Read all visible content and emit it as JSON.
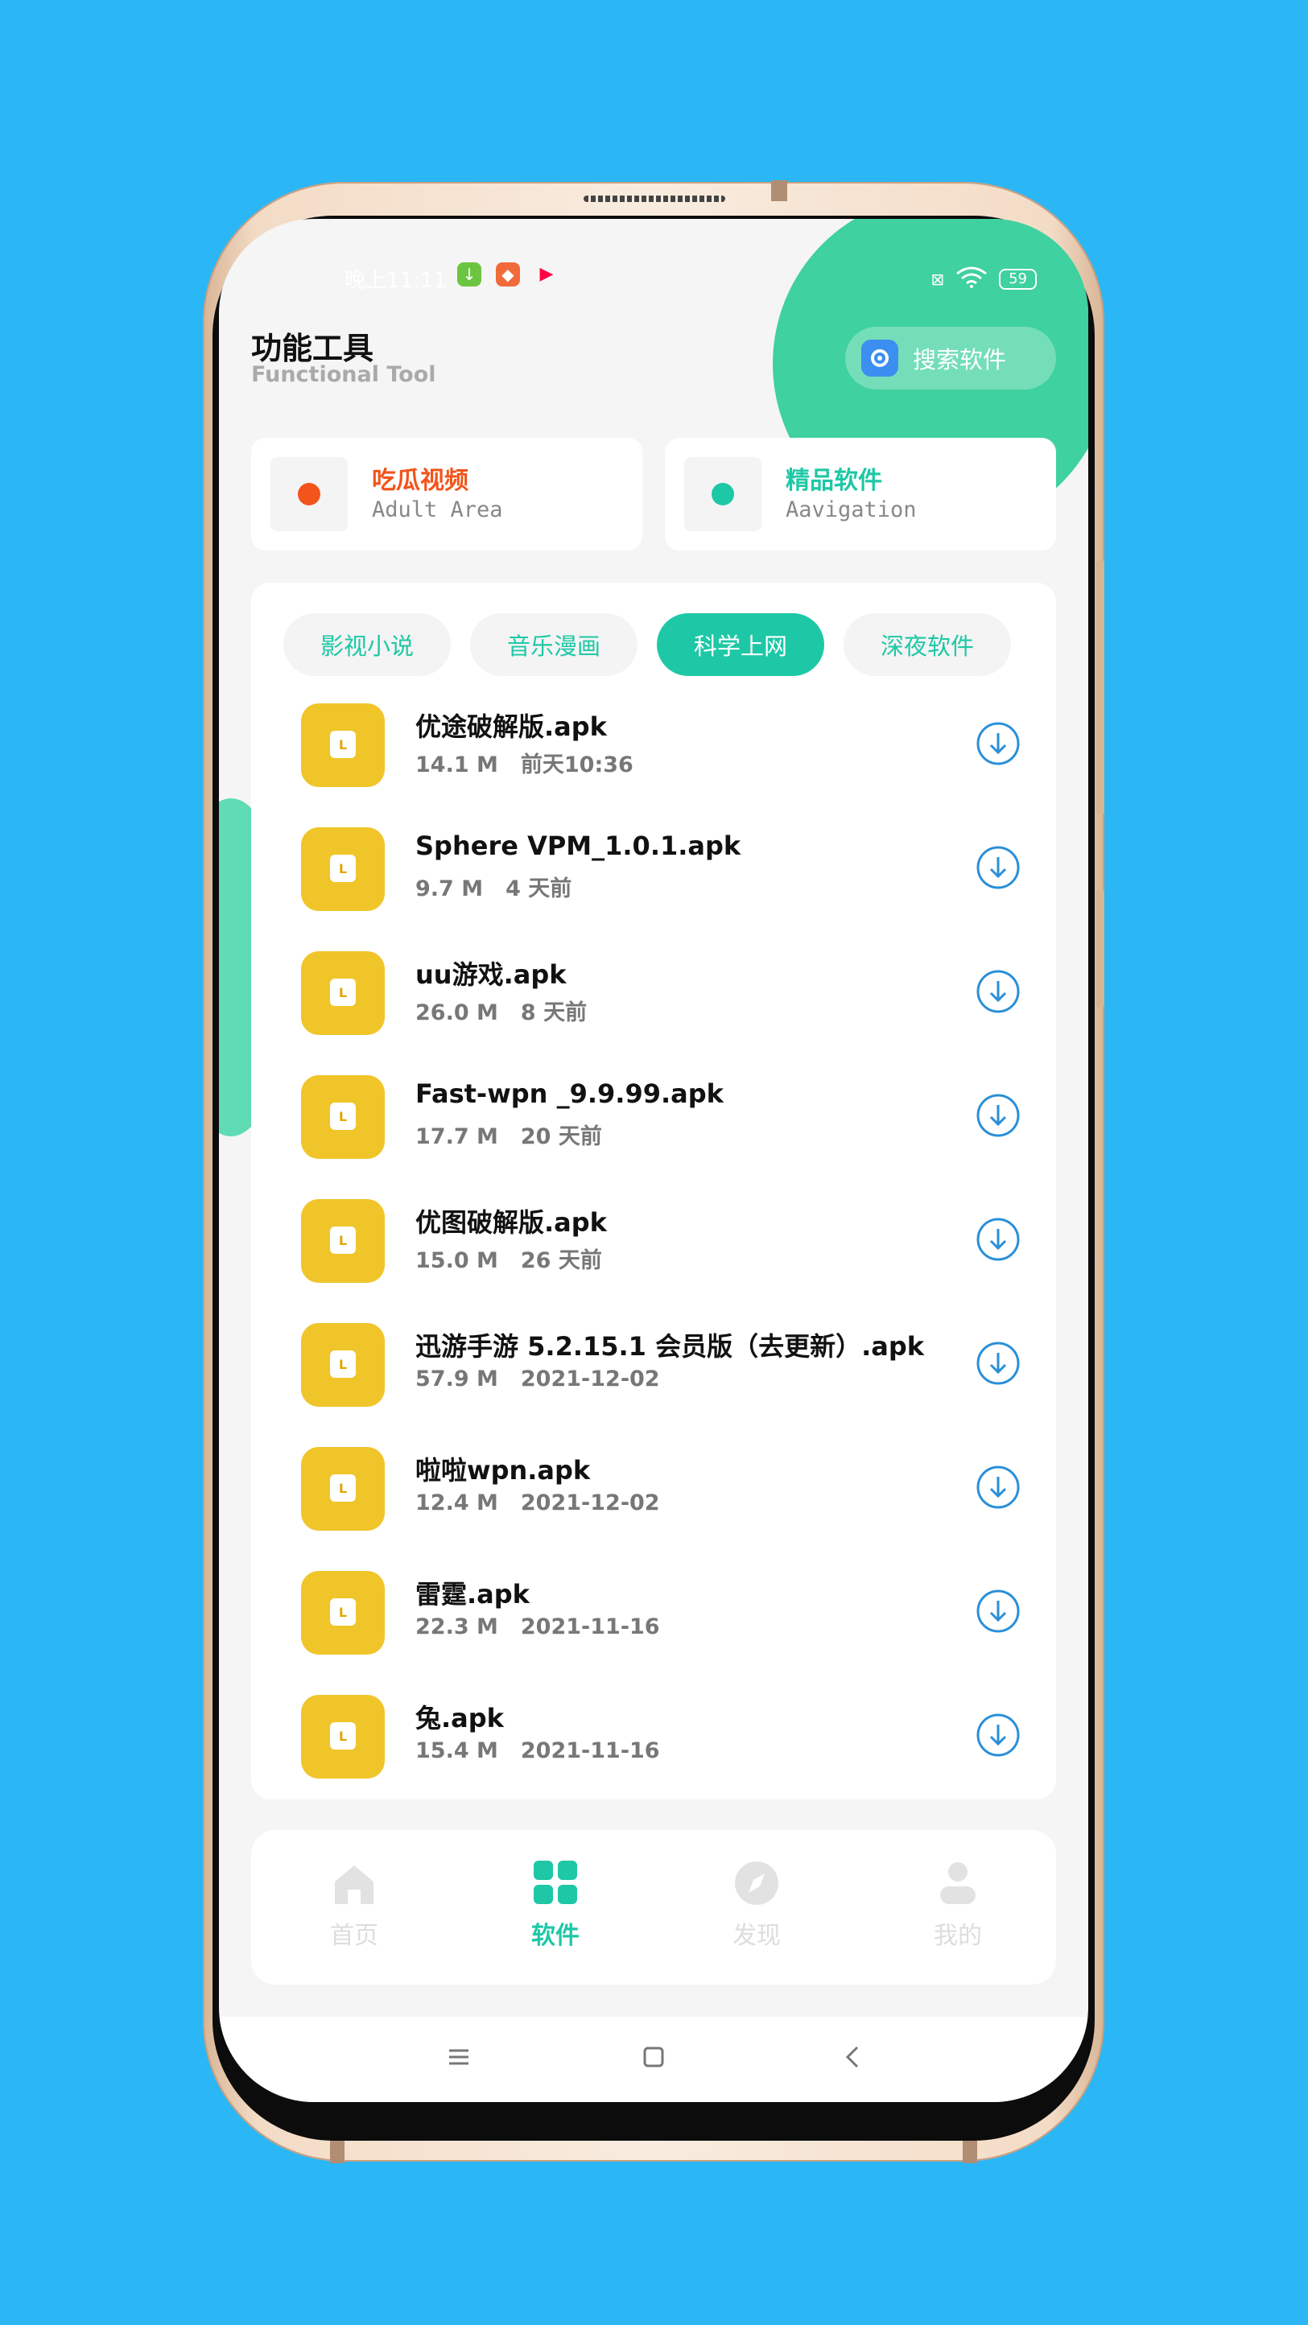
{
  "status_bar": {
    "time": "晚上11:11",
    "battery": "59"
  },
  "header": {
    "title": "功能工具",
    "subtitle": "Functional Tool",
    "search_label": "搜索软件"
  },
  "cards": [
    {
      "title": "吃瓜视频",
      "subtitle": "Adult Area",
      "color": "#f2541b"
    },
    {
      "title": "精品软件",
      "subtitle": "Aavigation",
      "color": "#1ec8a6"
    }
  ],
  "tabs": [
    "影视小说",
    "音乐漫画",
    "科学上网",
    "深夜软件"
  ],
  "active_tab": "科学上网",
  "files": [
    {
      "name": "优途破解版.apk",
      "size": "14.1 M",
      "date": "前天10:36"
    },
    {
      "name": "Sphere VPM_1.0.1.apk",
      "size": "9.7 M",
      "date": "4 天前"
    },
    {
      "name": "uu游戏.apk",
      "size": "26.0 M",
      "date": "8 天前"
    },
    {
      "name": "Fast-wpn _9.9.99.apk",
      "size": "17.7 M",
      "date": "20 天前"
    },
    {
      "name": "优图破解版.apk",
      "size": "15.0 M",
      "date": "26 天前"
    },
    {
      "name": "迅游手游 5.2.15.1 会员版（去更新）.apk",
      "size": "57.9 M",
      "date": "2021-12-02"
    },
    {
      "name": "啦啦wpn.apk",
      "size": "12.4 M",
      "date": "2021-12-02"
    },
    {
      "name": "雷霆.apk",
      "size": "22.3 M",
      "date": "2021-11-16"
    },
    {
      "name": "兔.apk",
      "size": "15.4 M",
      "date": "2021-11-16"
    }
  ],
  "app_icon_letter": "L",
  "nav": [
    {
      "label": "首页",
      "icon": "home-icon"
    },
    {
      "label": "软件",
      "icon": "apps-grid-icon"
    },
    {
      "label": "发现",
      "icon": "compass-icon"
    },
    {
      "label": "我的",
      "icon": "user-icon"
    }
  ],
  "active_nav": "软件",
  "colors": {
    "accent": "#1ec8a6",
    "background": "#2bb6f5",
    "icon_yellow": "#f0c52a",
    "download_blue": "#2a8fd8"
  }
}
